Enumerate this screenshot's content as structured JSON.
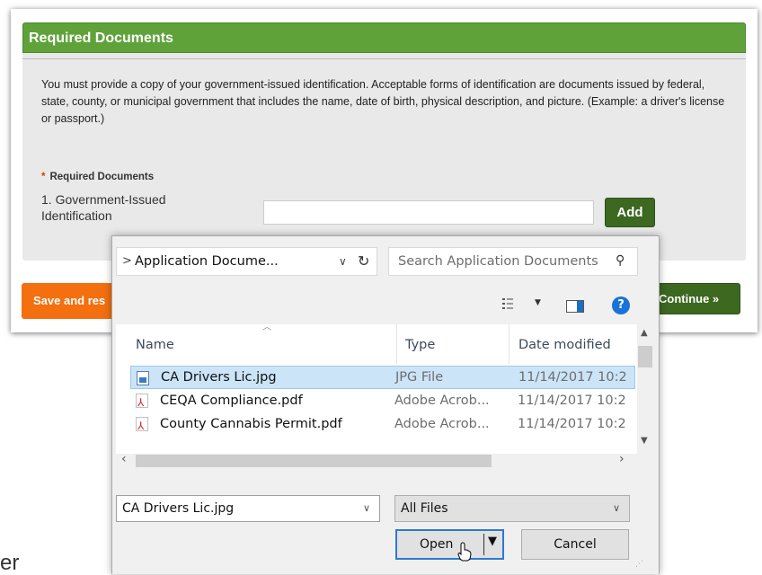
{
  "panel": {
    "title": "Required Documents",
    "instructions": "You must provide a copy of your government-issued identification.  Acceptable forms of identification are documents issued by federal, state, county, or municipal government that includes the name, date of birth, physical description, and picture. (Example: a driver's license or passport.)",
    "required_marker": "*",
    "required_heading": "Required Documents",
    "document_label": "1. Government-Issued Identification",
    "document_value": "",
    "add_label": "Add"
  },
  "actions": {
    "save_label": "Save and res",
    "continue_label": "Continue »"
  },
  "partial_text": "er",
  "dialog": {
    "address": "Application Docume...",
    "search_placeholder": "Search Application Documents",
    "help_label": "?",
    "columns": [
      "Name",
      "Type",
      "Date modified"
    ],
    "files": [
      {
        "name": "CA Drivers Lic.jpg",
        "type": "JPG File",
        "date": "11/14/2017 10:2",
        "icon": "image-file-icon",
        "selected": true
      },
      {
        "name": "CEQA Compliance.pdf",
        "type": "Adobe Acrob...",
        "date": "11/14/2017 10:2",
        "icon": "pdf-file-icon",
        "selected": false
      },
      {
        "name": "County Cannabis Permit.pdf",
        "type": "Adobe Acrob...",
        "date": "11/14/2017 10:2",
        "icon": "pdf-file-icon",
        "selected": false
      }
    ],
    "filename_value": "CA Drivers Lic.jpg",
    "filetype_value": "All Files",
    "open_label": "Open",
    "cancel_label": "Cancel"
  },
  "colors": {
    "header_green": "#5fa23a",
    "button_green": "#3c6820",
    "save_orange": "#f36f10",
    "selection_blue": "#cce4f7",
    "focus_blue": "#2a7ad6"
  }
}
